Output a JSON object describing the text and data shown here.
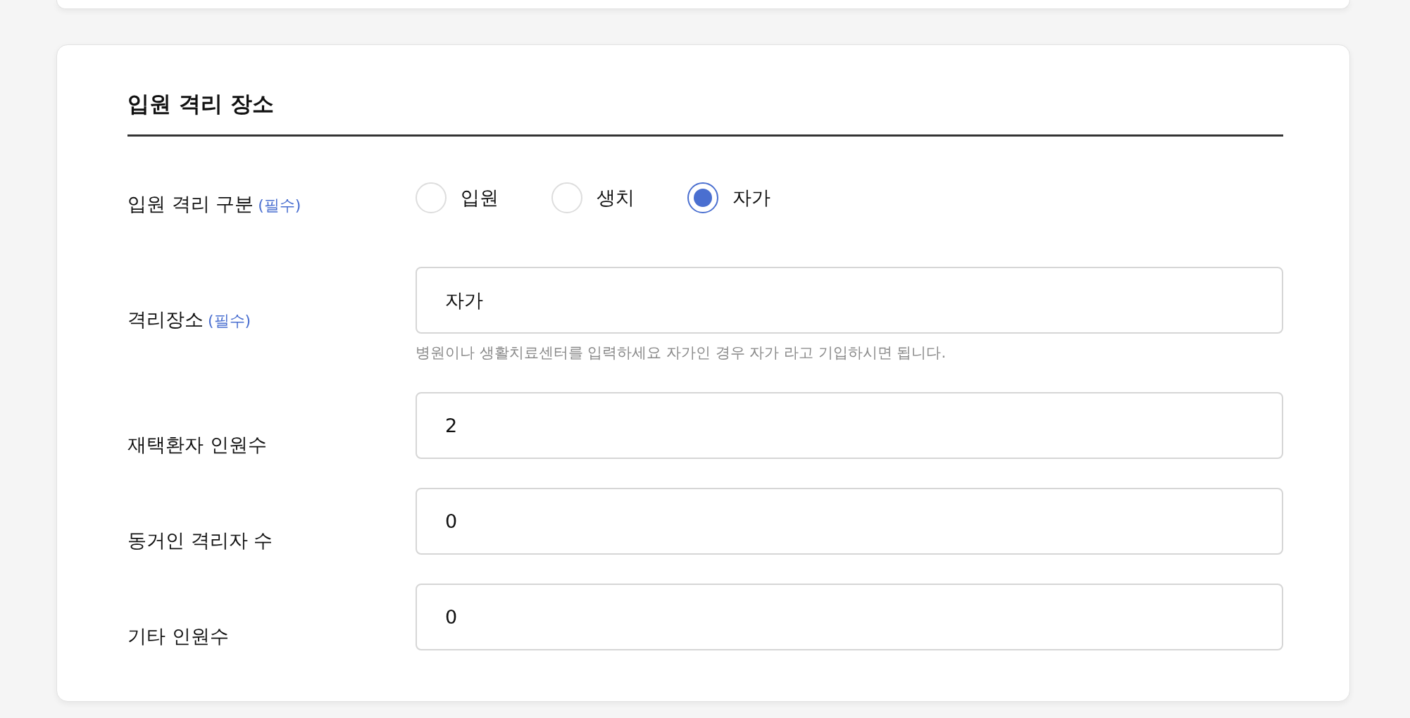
{
  "section": {
    "title": "입원 격리 장소",
    "isolation_type": {
      "label": "입원 격리 구분",
      "required": "(필수)",
      "options": [
        {
          "label": "입원",
          "selected": false
        },
        {
          "label": "생치",
          "selected": false
        },
        {
          "label": "자가",
          "selected": true
        }
      ]
    },
    "fields": [
      {
        "label": "격리장소",
        "required": "(필수)",
        "value": "자가",
        "hint": "병원이나 생활치료센터를 입력하세요 자가인 경우 자가 라고 기입하시면 됩니다."
      },
      {
        "label": "재택환자 인원수",
        "value": "2"
      },
      {
        "label": "동거인 격리자 수",
        "value": "0"
      },
      {
        "label": "기타 인원수",
        "value": "0"
      }
    ]
  }
}
